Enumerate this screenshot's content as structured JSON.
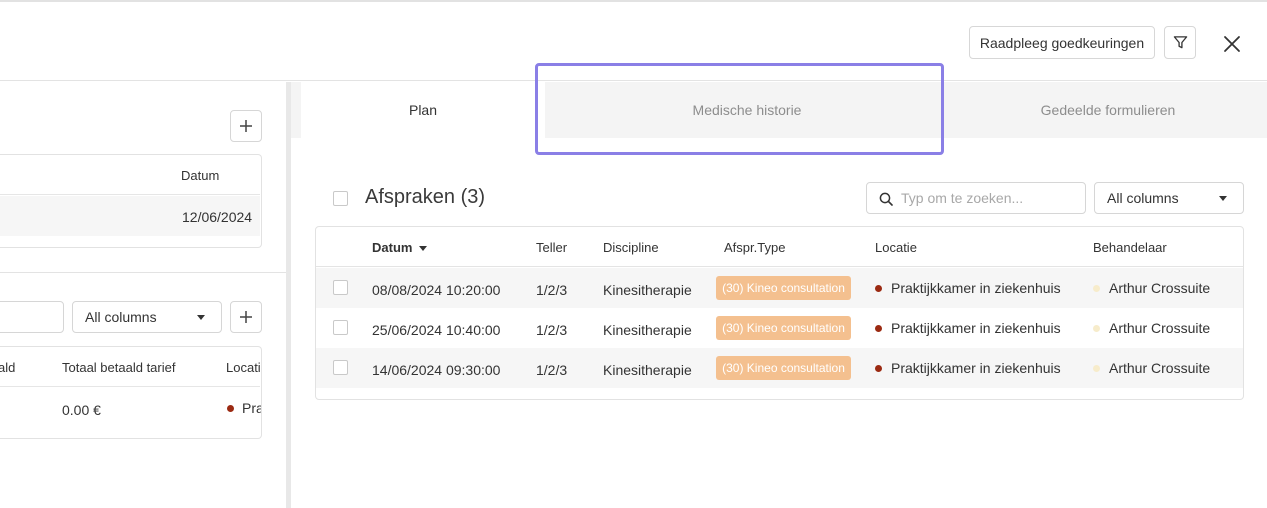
{
  "header": {
    "approvals_label": "Raadpleeg goedkeuringen",
    "filter_icon": "filter-icon",
    "close_icon": "close-icon"
  },
  "left": {
    "table1": {
      "header_date": "Datum",
      "row_date": "12/06/2024"
    },
    "filter_select": "All columns",
    "table2": {
      "headers": [
        "ald",
        "Totaal betaald tarief",
        "Locati"
      ],
      "row_amount": "0.00 €",
      "row_location": "Pra"
    }
  },
  "tabs": {
    "plan": "Plan",
    "medical": "Medische historie",
    "forms": "Gedeelde formulieren"
  },
  "appointments": {
    "title": "Afspraken (3)",
    "search_placeholder": "Typ om te zoeken...",
    "columns_select": "All columns",
    "headers": {
      "date": "Datum",
      "counter": "Teller",
      "discipline": "Discipline",
      "type": "Afspr.Type",
      "location": "Locatie",
      "practitioner": "Behandelaar"
    },
    "rows": [
      {
        "date": "08/08/2024 10:20:00",
        "counter": "1/2/3",
        "discipline": "Kinesitherapie",
        "type": "(30) Kineo consultation",
        "location": "Praktijkkamer in ziekenhuis",
        "practitioner": "Arthur Crossuite"
      },
      {
        "date": "25/06/2024 10:40:00",
        "counter": "1/2/3",
        "discipline": "Kinesitherapie",
        "type": "(30) Kineo consultation",
        "location": "Praktijkkamer in ziekenhuis",
        "practitioner": "Arthur Crossuite"
      },
      {
        "date": "14/06/2024 09:30:00",
        "counter": "1/2/3",
        "discipline": "Kinesitherapie",
        "type": "(30) Kineo consultation",
        "location": "Praktijkkamer in ziekenhuis",
        "practitioner": "Arthur Crossuite"
      }
    ]
  },
  "colors": {
    "accent_outline": "#8a7fe6",
    "badge": "#f4c08f",
    "location_dot": "#9b2a12",
    "practitioner_dot": "#f7eccb"
  }
}
